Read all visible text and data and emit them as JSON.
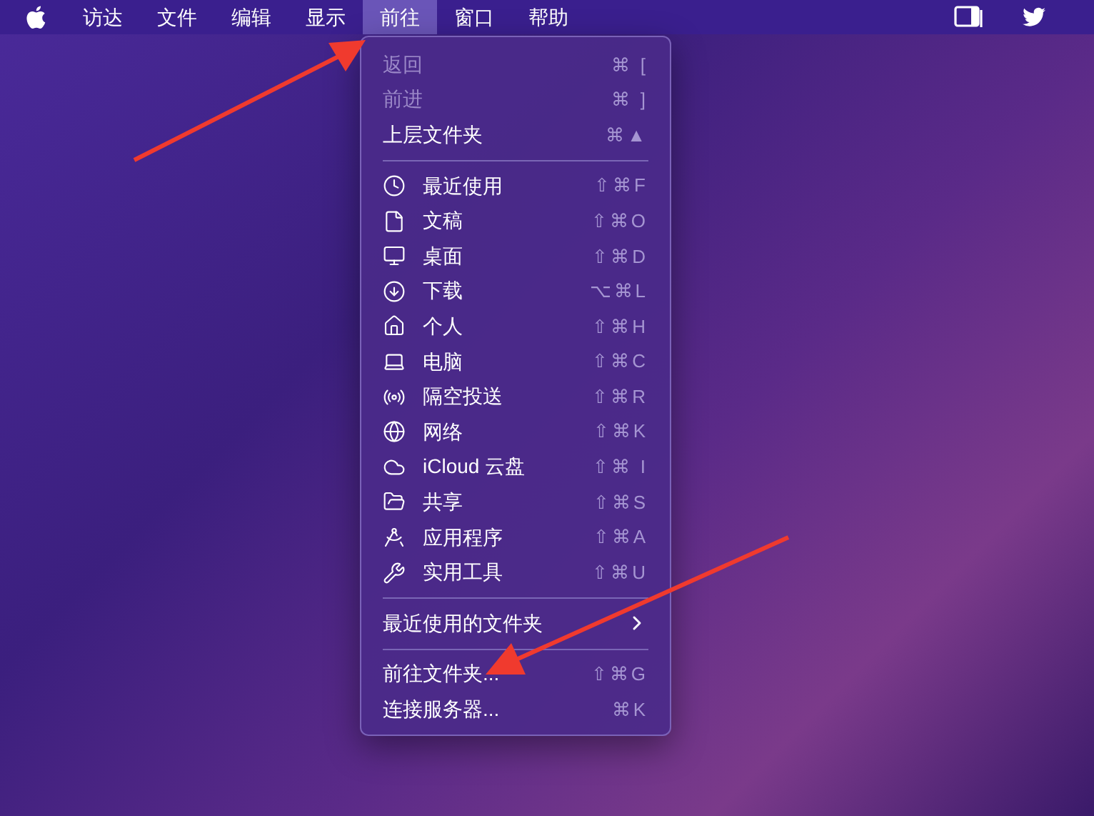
{
  "menu_bar": {
    "items": [
      {
        "label": "访达",
        "selected": false
      },
      {
        "label": "文件",
        "selected": false
      },
      {
        "label": "编辑",
        "selected": false
      },
      {
        "label": "显示",
        "selected": false
      },
      {
        "label": "前往",
        "selected": true
      },
      {
        "label": "窗口",
        "selected": false
      },
      {
        "label": "帮助",
        "selected": false
      }
    ]
  },
  "menu": {
    "sections": [
      [
        {
          "kind": "plain",
          "label": "返回",
          "shortcut": "⌘ [",
          "disabled": true
        },
        {
          "kind": "plain",
          "label": "前进",
          "shortcut": "⌘ ]",
          "disabled": true
        },
        {
          "kind": "plain",
          "label": "上层文件夹",
          "shortcut": "⌘▲",
          "disabled": false
        }
      ],
      [
        {
          "kind": "place",
          "label": "最近使用",
          "shortcut": "⇧⌘F",
          "disabled": false
        },
        {
          "kind": "place",
          "label": "文稿",
          "shortcut": "⇧⌘O",
          "disabled": false
        },
        {
          "kind": "place",
          "label": "桌面",
          "shortcut": "⇧⌘D",
          "disabled": false
        },
        {
          "kind": "place",
          "label": "下载",
          "shortcut": "⌥⌘L",
          "disabled": false
        },
        {
          "kind": "place",
          "label": "个人",
          "shortcut": "⇧⌘H",
          "disabled": false
        },
        {
          "kind": "place",
          "label": "电脑",
          "shortcut": "⇧⌘C",
          "disabled": false
        },
        {
          "kind": "place",
          "label": "隔空投送",
          "shortcut": "⇧⌘R",
          "disabled": false
        },
        {
          "kind": "place",
          "label": "网络",
          "shortcut": "⇧⌘K",
          "disabled": false
        },
        {
          "kind": "place",
          "label": "iCloud 云盘",
          "shortcut": "⇧⌘ I",
          "disabled": false
        },
        {
          "kind": "place",
          "label": "共享",
          "shortcut": "⇧⌘S",
          "disabled": false
        },
        {
          "kind": "place",
          "label": "应用程序",
          "shortcut": "⇧⌘A",
          "disabled": false
        },
        {
          "kind": "place",
          "label": "实用工具",
          "shortcut": "⇧⌘U",
          "disabled": false
        }
      ],
      [
        {
          "kind": "submenu",
          "label": "最近使用的文件夹",
          "disabled": false
        }
      ],
      [
        {
          "kind": "plain",
          "label": "前往文件夹...",
          "shortcut": "⇧⌘G",
          "disabled": false
        },
        {
          "kind": "plain",
          "label": "连接服务器...",
          "shortcut": "⌘K",
          "disabled": false
        }
      ]
    ]
  }
}
